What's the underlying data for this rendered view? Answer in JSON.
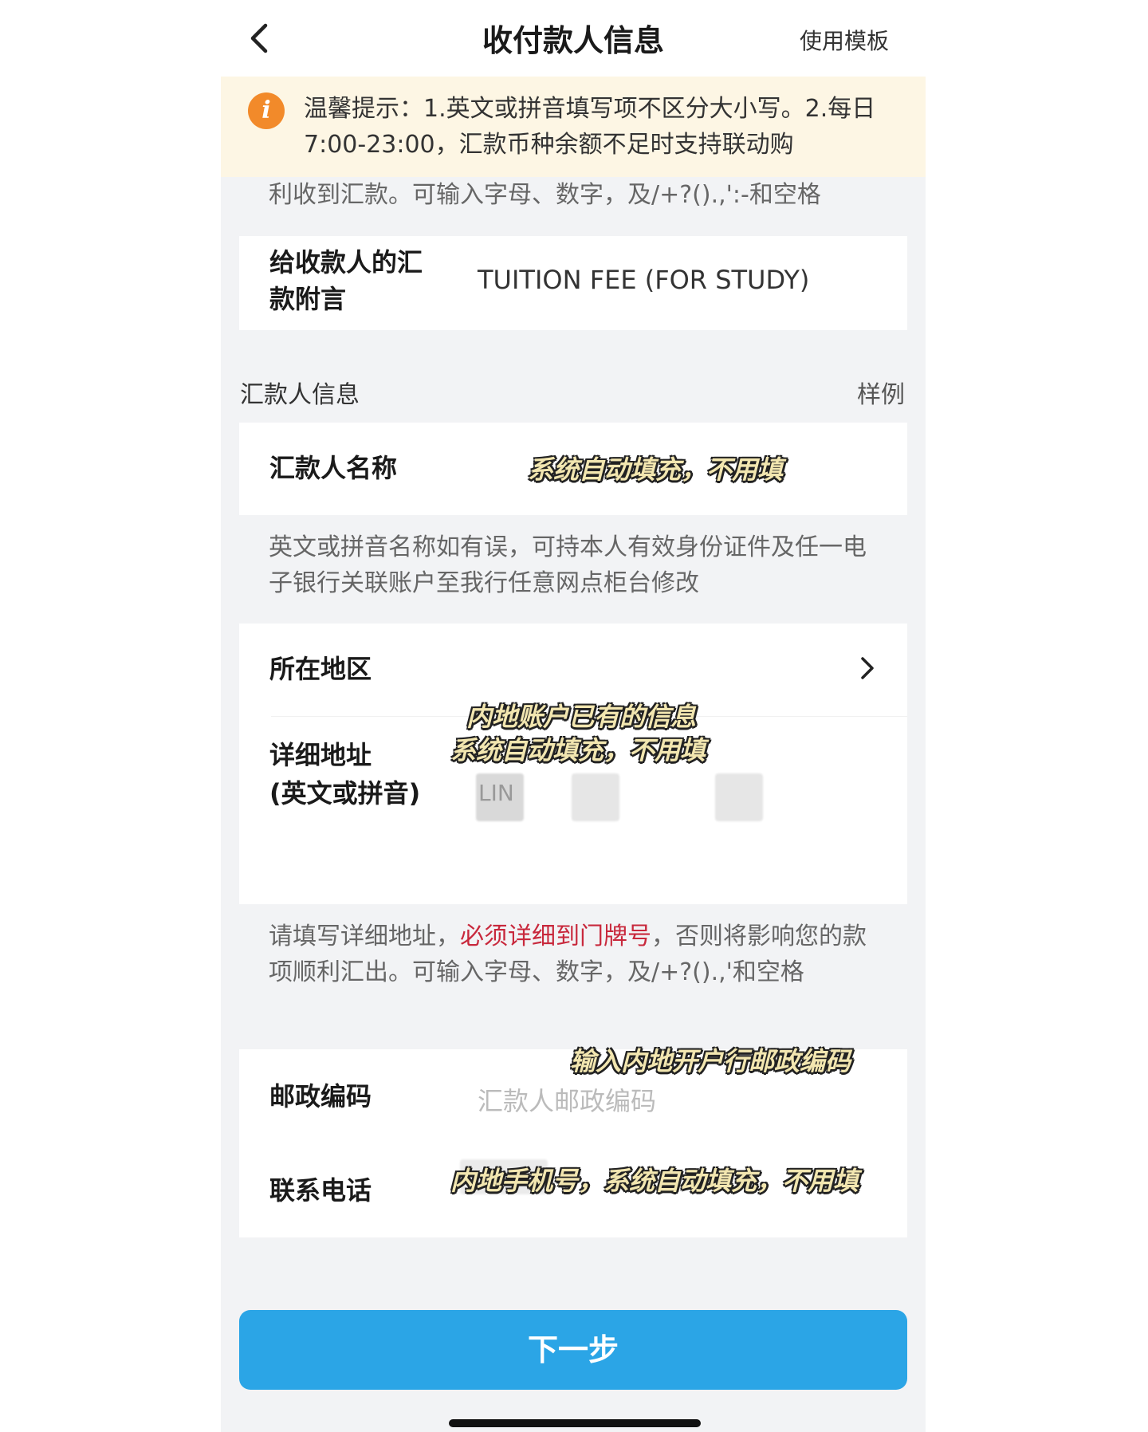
{
  "nav": {
    "back_icon": "chevron-left-icon",
    "title": "收付款人信息",
    "template_label": "使用模板"
  },
  "notice": {
    "icon": "info-icon",
    "icon_glyph": "i",
    "text": "温馨提示：1.英文或拼音填写项不区分大小写。2.每日7:00-23:00，汇款币种余额不足时支持联动购",
    "continued_text": "利收到汇款。可输入字母、数字，及/+?().,':-和空格"
  },
  "memo": {
    "label": "给收款人的汇款附言",
    "value": "TUITION FEE (FOR STUDY)"
  },
  "remitter_section": {
    "title": "汇款人信息",
    "sample_link": "样例"
  },
  "remitter_name": {
    "label": "汇款人名称",
    "overlay": "系统自动填充，不用填"
  },
  "name_hint": "英文或拼音名称如有误，可持本人有效身份证件及任一电子银行关联账户至我行任意网点柜台修改",
  "region": {
    "label": "所在地区",
    "chevron_icon": "chevron-right-icon"
  },
  "address": {
    "label_line1": "详细地址",
    "label_line2": "(英文或拼音)",
    "overlay_line1": "内地账户已有的信息",
    "overlay_line2": "系统自动填充，不用填",
    "value": "LIN"
  },
  "address_hint": {
    "part1": "请填写详细地址，",
    "part2": "必须详细到门牌号",
    "part3": "，否则将影响您的款项顺利汇出。可输入字母、数字，及/+?().,'和空格"
  },
  "postal": {
    "label": "邮政编码",
    "placeholder": "汇款人邮政编码",
    "overlay": "输入内地开户行邮政编码"
  },
  "phone": {
    "label": "联系电话",
    "overlay": "内地手机号，系统自动填充，不用填"
  },
  "next_button": "下一步",
  "colors": {
    "primary_button": "#2ba5e6",
    "notice_bg": "#fdf6e4",
    "info_icon": "#f28a2a",
    "warning_text": "#c8283c",
    "page_bg": "#f2f3f5"
  }
}
